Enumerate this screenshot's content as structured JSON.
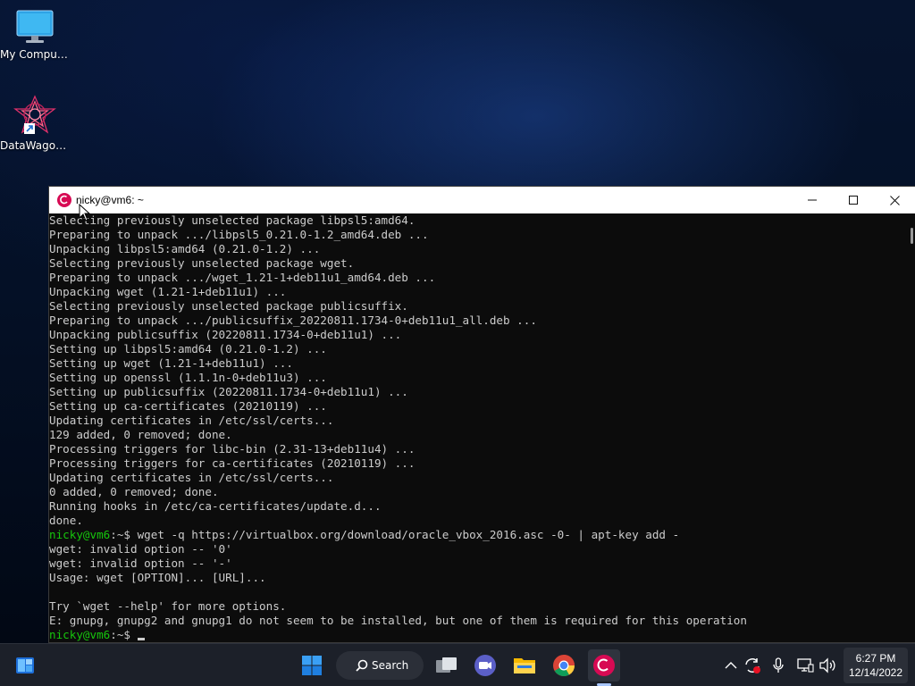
{
  "desktop": {
    "icons": [
      {
        "label": "My Computer",
        "icon": "monitor-icon"
      },
      {
        "label": "DataWagon...",
        "icon": "datawagon-app-icon"
      }
    ]
  },
  "terminal": {
    "title": "nicky@vm6: ~",
    "lines": [
      {
        "text": "Selecting previously unselected package libpsl5:amd64."
      },
      {
        "text": "Preparing to unpack .../libpsl5_0.21.0-1.2_amd64.deb ..."
      },
      {
        "text": "Unpacking libpsl5:amd64 (0.21.0-1.2) ..."
      },
      {
        "text": "Selecting previously unselected package wget."
      },
      {
        "text": "Preparing to unpack .../wget_1.21-1+deb11u1_amd64.deb ..."
      },
      {
        "text": "Unpacking wget (1.21-1+deb11u1) ..."
      },
      {
        "text": "Selecting previously unselected package publicsuffix."
      },
      {
        "text": "Preparing to unpack .../publicsuffix_20220811.1734-0+deb11u1_all.deb ..."
      },
      {
        "text": "Unpacking publicsuffix (20220811.1734-0+deb11u1) ..."
      },
      {
        "text": "Setting up libpsl5:amd64 (0.21.0-1.2) ..."
      },
      {
        "text": "Setting up wget (1.21-1+deb11u1) ..."
      },
      {
        "text": "Setting up openssl (1.1.1n-0+deb11u3) ..."
      },
      {
        "text": "Setting up publicsuffix (20220811.1734-0+deb11u1) ..."
      },
      {
        "text": "Setting up ca-certificates (20210119) ..."
      },
      {
        "text": "Updating certificates in /etc/ssl/certs..."
      },
      {
        "text": "129 added, 0 removed; done."
      },
      {
        "text": "Processing triggers for libc-bin (2.31-13+deb11u4) ..."
      },
      {
        "text": "Processing triggers for ca-certificates (20210119) ..."
      },
      {
        "text": "Updating certificates in /etc/ssl/certs..."
      },
      {
        "text": "0 added, 0 removed; done."
      },
      {
        "text": "Running hooks in /etc/ca-certificates/update.d..."
      },
      {
        "text": "done."
      },
      {
        "prompt": "nicky@vm6",
        "path": ":~$",
        "text": " wget -q https://virtualbox.org/download/oracle_vbox_2016.asc -0- | apt-key add -"
      },
      {
        "text": "wget: invalid option -- '0'"
      },
      {
        "text": "wget: invalid option -- '-'"
      },
      {
        "text": "Usage: wget [OPTION]... [URL]..."
      },
      {
        "text": ""
      },
      {
        "text": "Try `wget --help' for more options."
      },
      {
        "text": "E: gnupg, gnupg2 and gnupg1 do not seem to be installed, but one of them is required for this operation"
      },
      {
        "prompt": "nicky@vm6",
        "path": ":~$",
        "text": " ",
        "cursor": true
      }
    ]
  },
  "taskbar": {
    "search_label": "Search",
    "clock_time": "6:27 PM",
    "clock_date": "12/14/2022",
    "apps": [
      "widgets-icon",
      "start-icon",
      "search-icon",
      "task-view-icon",
      "meet-icon",
      "file-explorer-icon",
      "chrome-icon",
      "debian-terminal-icon"
    ],
    "tray": [
      "chevron-up-icon",
      "sync-icon",
      "microphone-icon",
      "network-icon",
      "volume-icon"
    ]
  },
  "colors": {
    "prompt": "#16c60c",
    "terminal_bg": "#0c0c0c",
    "terminal_fg": "#cccccc",
    "taskbar_bg": "#1c2029",
    "debian_red": "#d70a53"
  }
}
